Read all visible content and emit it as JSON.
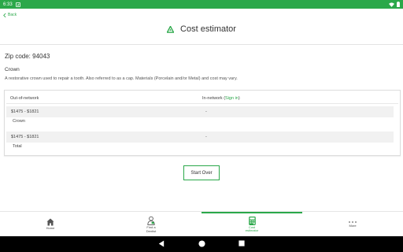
{
  "status_bar": {
    "time": "6:33"
  },
  "back": {
    "label": "Back"
  },
  "header": {
    "title": "Cost estimator"
  },
  "zip": {
    "text": "Zip code: 94043"
  },
  "procedure": {
    "name": "Crown",
    "description": "A restorative crown used to repair a tooth. Also referred to as a cap. Materials (Porcelain and/or Metal) and cost may vary."
  },
  "table": {
    "col_out": "Out-of-network",
    "col_in_prefix": "In-network (",
    "col_in_link": "Sign in",
    "col_in_suffix": ")",
    "rows": [
      {
        "out": "$1475 - $1821",
        "in": "-",
        "label": "Crown"
      },
      {
        "out": "$1475 - $1821",
        "in": "-",
        "label": "Total"
      }
    ]
  },
  "start_over": {
    "label": "Start Over"
  },
  "nav": {
    "home": "Home",
    "find_dentist_1": "Find a",
    "find_dentist_2": "Dentist",
    "cost_1": "Cost",
    "cost_2": "estimator",
    "more": "More"
  },
  "colors": {
    "accent": "#2ba84a"
  },
  "icons": [
    "wifi-icon",
    "battery-icon",
    "back-chevron-icon",
    "estimator-logo-icon",
    "home-icon",
    "dentist-icon",
    "calculator-icon",
    "more-dots-icon"
  ]
}
